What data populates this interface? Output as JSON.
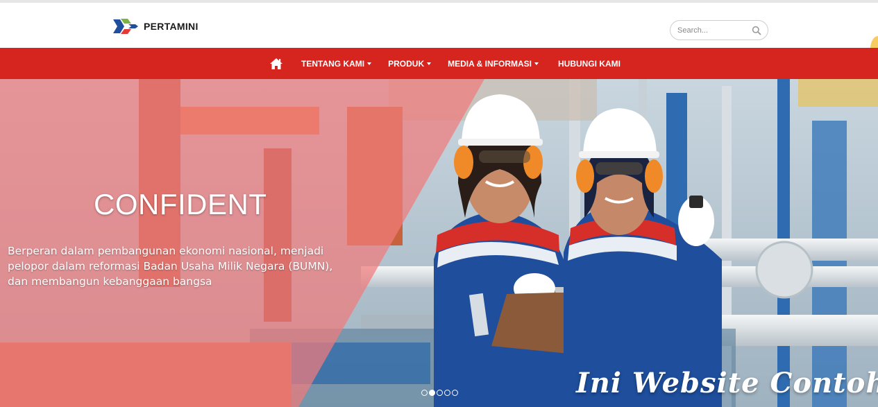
{
  "header": {
    "logo_text": "PERTAMINI",
    "search": {
      "placeholder": "Search...",
      "value": ""
    }
  },
  "nav": {
    "home_icon": "home-icon",
    "items": [
      {
        "label": "TENTANG KAMI",
        "dropdown": true
      },
      {
        "label": "PRODUK",
        "dropdown": true
      },
      {
        "label": "MEDIA & INFORMASI",
        "dropdown": true
      },
      {
        "label": "HUBUNGI KAMI",
        "dropdown": false
      }
    ]
  },
  "hero": {
    "title": "CONFIDENT",
    "text": "Berperan dalam pembangunan ekonomi nasional, menjadi pelopor dalam reformasi Badan Usaha Milik Negara (BUMN), dan membangun kebanggaan bangsa",
    "slides_count": 5,
    "active_slide": 1
  },
  "watermark": "Ini Website Contoh",
  "colors": {
    "nav_red": "#d6241f",
    "logo_blue": "#1f4e9c",
    "logo_green": "#7cb342",
    "logo_red": "#e53935",
    "overlay_pink": "#f07b7b"
  }
}
